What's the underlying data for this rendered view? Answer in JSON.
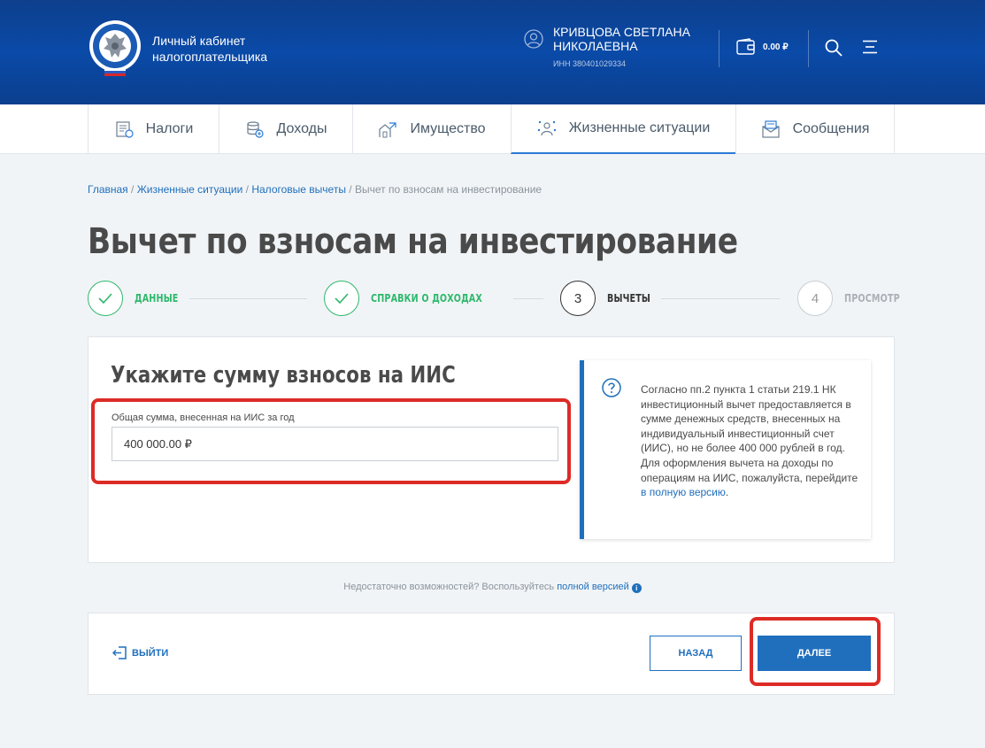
{
  "header": {
    "brand_line1": "Личный кабинет",
    "brand_line2": "налогоплательщика",
    "user_name_line1": "КРИВЦОВА СВЕТЛАНА",
    "user_name_line2": "НИКОЛАЕВНА",
    "user_inn": "ИНН 380401029334",
    "balance": "0.00 ₽",
    "colors": {
      "background": "#0b47a0",
      "text": "#ffffff"
    }
  },
  "nav": {
    "items": [
      {
        "label": "Налоги",
        "icon": "taxes-icon",
        "active": false
      },
      {
        "label": "Доходы",
        "icon": "income-icon",
        "active": false
      },
      {
        "label": "Имущество",
        "icon": "property-icon",
        "active": false
      },
      {
        "label": "Жизненные ситуации",
        "icon": "life-situations-icon",
        "active": true
      },
      {
        "label": "Сообщения",
        "icon": "messages-icon",
        "active": false
      }
    ]
  },
  "breadcrumb": {
    "items": [
      "Главная",
      "Жизненные ситуации",
      "Налоговые вычеты"
    ],
    "separator": " / ",
    "current": "Вычет по взносам на инвестирование"
  },
  "page_title": "Вычет по взносам на инвестирование",
  "stepper": {
    "steps": [
      {
        "number": "1",
        "label": "ДАННЫЕ",
        "state": "done"
      },
      {
        "number": "2",
        "label": "СПРАВКИ О ДОХОДАХ",
        "state": "done"
      },
      {
        "number": "3",
        "label": "ВЫЧЕТЫ",
        "state": "current"
      },
      {
        "number": "4",
        "label": "ПРОСМОТР",
        "state": "future"
      }
    ],
    "colors": {
      "done": "#2eb86c",
      "current": "#333333",
      "future": "#aab0b6"
    }
  },
  "form": {
    "title": "Укажите сумму взносов на ИИС",
    "field_label": "Общая сумма, внесенная на ИИС за год",
    "field_value": "400 000.00 ₽"
  },
  "info": {
    "text": "Согласно пп.2 пункта 1 статьи 219.1 НК инвестиционный вычет предоставляется в сумме денежных средств, внесенных на индивидуальный инвестиционный счет (ИИС), но не более 400 000 рублей в год. Для оформления вычета на доходы по операциям на ИИС, пожалуйста, перейдите ",
    "link": "в полную версию",
    "tail": "."
  },
  "hint": {
    "text": "Недостаточно возможностей? Воспользуйтесь ",
    "link": "полной версией",
    "icon": "i"
  },
  "actions": {
    "exit": "ВЫЙТИ",
    "back": "НАЗАД",
    "next": "ДАЛЕЕ"
  },
  "accent_color": "#1f6fbd",
  "highlight_color": "#dd2b26"
}
